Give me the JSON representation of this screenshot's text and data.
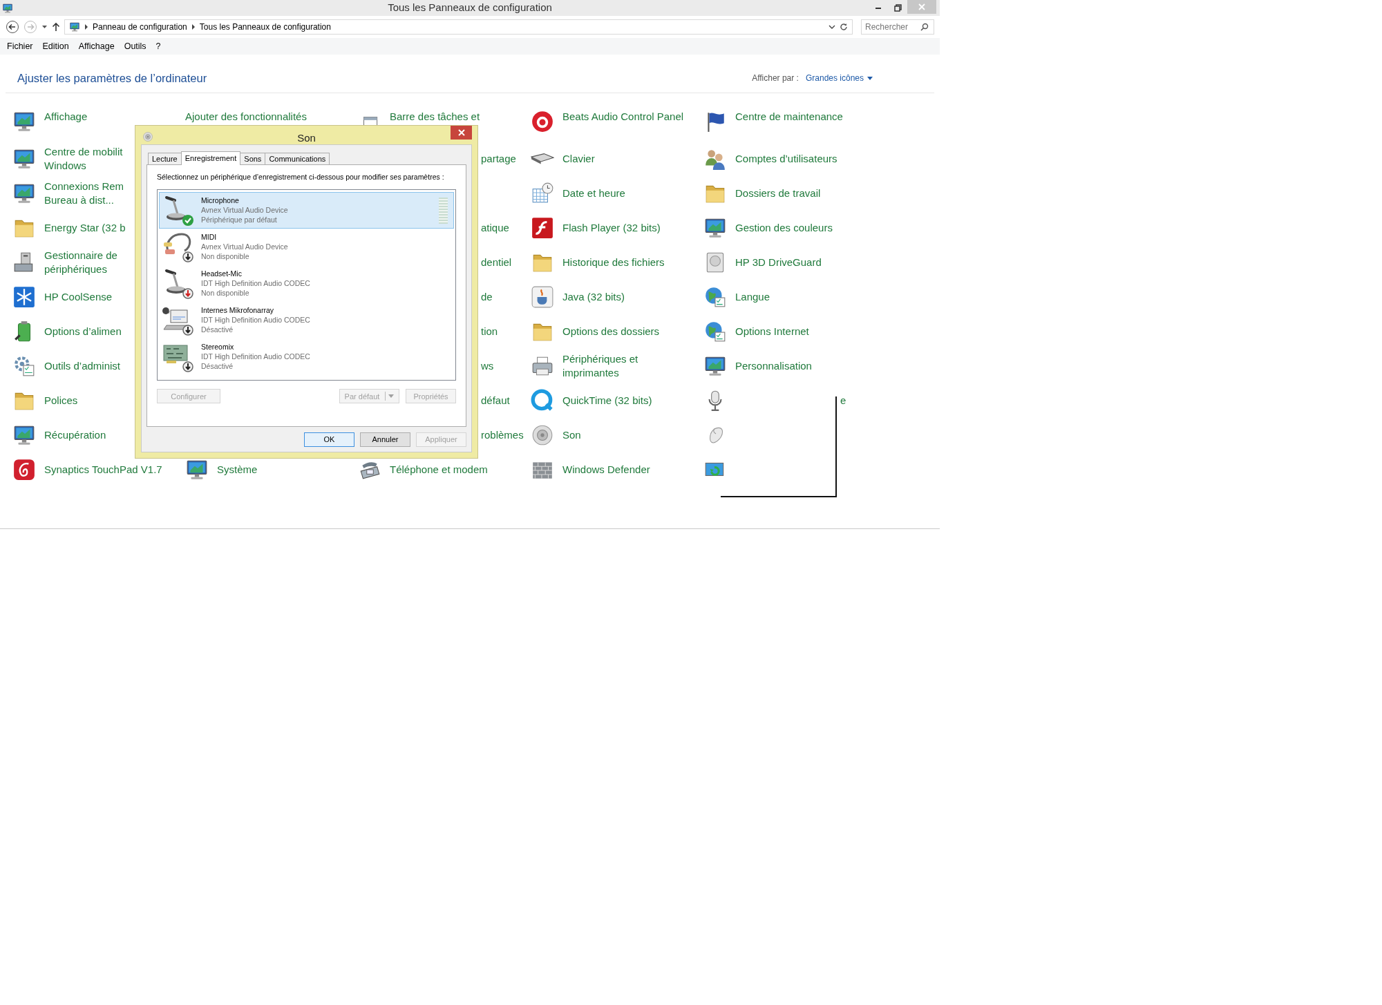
{
  "window": {
    "title": "Tous les Panneaux de configuration"
  },
  "address_bar": {
    "path": [
      "Panneau de configuration",
      "Tous les Panneaux de configuration"
    ]
  },
  "search": {
    "placeholder": "Rechercher"
  },
  "menu": [
    "Fichier",
    "Edition",
    "Affichage",
    "Outils",
    "?"
  ],
  "header": {
    "title": "Ajuster les paramètres de l’ordinateur",
    "view_label": "Afficher par :",
    "view_value": "Grandes icônes"
  },
  "grid": {
    "rows": [
      [
        {
          "label": "Affichage"
        },
        {
          "label": "Ajouter des fonctionnalités"
        },
        {
          "label": "Barre des tâches et"
        },
        {
          "label": "Beats Audio Control Panel"
        },
        {
          "label": "Centre de maintenance"
        }
      ],
      [
        {
          "label": "Centre de mobilit\nWindows"
        },
        {},
        {
          "tail": "partage"
        },
        {
          "label": "Clavier"
        },
        {
          "label": "Comptes d’utilisateurs"
        }
      ],
      [
        {
          "label": "Connexions Rem\nBureau à dist..."
        },
        {},
        {},
        {
          "label": "Date et heure"
        },
        {
          "label": "Dossiers de travail"
        }
      ],
      [
        {
          "label": "Energy Star (32 b"
        },
        {},
        {
          "tail": "atique"
        },
        {
          "label": "Flash Player (32 bits)"
        },
        {
          "label": "Gestion des couleurs"
        }
      ],
      [
        {
          "label": "Gestionnaire de\npériphériques"
        },
        {},
        {
          "tail": "dentiel"
        },
        {
          "label": "Historique des fichiers"
        },
        {
          "label": "HP 3D DriveGuard"
        }
      ],
      [
        {
          "label": "HP CoolSense"
        },
        {},
        {
          "tail": "de"
        },
        {
          "label": "Java (32 bits)"
        },
        {
          "label": "Langue"
        }
      ],
      [
        {
          "label": "Options d’alimen"
        },
        {},
        {
          "tail": "tion"
        },
        {
          "label": "Options des dossiers"
        },
        {
          "label": "Options Internet"
        }
      ],
      [
        {
          "label": "Outils d’administ"
        },
        {},
        {
          "tail": "ws"
        },
        {
          "label": "Périphériques et\nimprimantes"
        },
        {
          "label": "Personnalisation"
        }
      ],
      [
        {
          "label": "Polices"
        },
        {},
        {
          "tail": "défaut"
        },
        {
          "label": "QuickTime (32 bits)"
        },
        {
          "tail": "e"
        }
      ],
      [
        {
          "label": "Récupération"
        },
        {},
        {
          "tail": "roblèmes"
        },
        {
          "label": "Son"
        },
        {}
      ],
      [
        {
          "label": "Synaptics TouchPad V1.7"
        },
        {
          "label": "Système"
        },
        {
          "label": "Téléphone et modem"
        },
        {
          "label": "Windows Defender"
        },
        {}
      ]
    ]
  },
  "dialog": {
    "title": "Son",
    "tabs": [
      {
        "label": "Lecture",
        "selected": false
      },
      {
        "label": "Enregistrement",
        "selected": true
      },
      {
        "label": "Sons",
        "selected": false
      },
      {
        "label": "Communications",
        "selected": false
      }
    ],
    "instruction": "Sélectionnez un périphérique d’enregistrement ci-dessous pour modifier ses paramètres :",
    "devices": [
      {
        "kind": "microphone",
        "name": "Microphone",
        "driver": "Avnex Virtual Audio Device",
        "status": "Périphérique par défaut",
        "default": true,
        "unplugged": false,
        "selected": true,
        "level": 0
      },
      {
        "kind": "cable",
        "name": "MIDI",
        "driver": "Avnex Virtual Audio Device",
        "status": "Non disponible",
        "default": false,
        "unplugged": false,
        "selected": false
      },
      {
        "kind": "microphone",
        "name": "Headset-Mic",
        "driver": "IDT High Definition Audio CODEC",
        "status": "Non disponible",
        "default": false,
        "unplugged": true,
        "selected": false
      },
      {
        "kind": "laptop",
        "name": "Internes Mikrofonarray",
        "driver": "IDT High Definition Audio CODEC",
        "status": "Désactivé",
        "default": false,
        "unplugged": false,
        "selected": false
      },
      {
        "kind": "card",
        "name": "Stereomix",
        "driver": "IDT High Definition Audio CODEC",
        "status": "Désactivé",
        "default": false,
        "unplugged": false,
        "selected": false
      }
    ],
    "panel_buttons": [
      {
        "label": "Configurer",
        "kind": "plain",
        "disabled": true
      },
      {
        "label": "Par défaut",
        "kind": "split",
        "disabled": true
      },
      {
        "label": "Propriétés",
        "kind": "plain",
        "disabled": true
      }
    ],
    "buttons": [
      {
        "label": "OK",
        "default": true,
        "disabled": false
      },
      {
        "label": "Annuler",
        "default": false,
        "disabled": false
      },
      {
        "label": "Appliquer",
        "default": false,
        "disabled": true
      }
    ]
  }
}
